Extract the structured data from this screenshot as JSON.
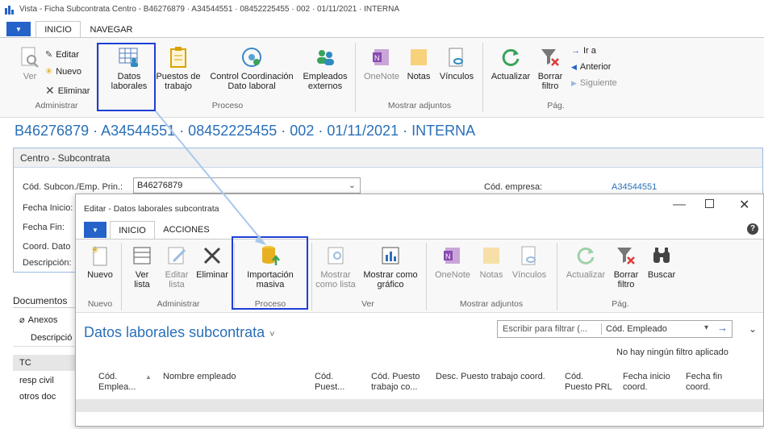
{
  "window": {
    "title": "Vista - Ficha Subcontrata Centro - B46276879 · A34544551 · 08452225455 · 002 · 01/11/2021 · INTERNA"
  },
  "main_tabs": {
    "inicio": "INICIO",
    "navegar": "NAVEGAR"
  },
  "main_ribbon": {
    "ver": "Ver",
    "editar": "Editar",
    "nuevo": "Nuevo",
    "eliminar": "Eliminar",
    "group_admin": "Administrar",
    "datos_laborales_1": "Datos",
    "datos_laborales_2": "laborales",
    "puestos_1": "Puestos de",
    "puestos_2": "trabajo",
    "control_1": "Control Coordinación",
    "control_2": "Dato laboral",
    "empleados_1": "Empleados",
    "empleados_2": "externos",
    "group_proceso": "Proceso",
    "onenote": "OneNote",
    "notas": "Notas",
    "vinculos": "Vínculos",
    "group_adjuntos": "Mostrar adjuntos",
    "actualizar": "Actualizar",
    "borrar_1": "Borrar",
    "borrar_2": "filtro",
    "ira": "Ir a",
    "anterior": "Anterior",
    "siguiente": "Siguiente",
    "group_pag": "Pág."
  },
  "page_title": "B46276879 · A34544551 · 08452225455 · 002 · 01/11/2021 · INTERNA",
  "centro": {
    "header": "Centro - Subcontrata",
    "cod_label": "Cód. Subcon./Emp. Prin.:",
    "cod_value": "B46276879",
    "fecha_inicio_label": "Fecha Inicio:",
    "fecha_fin_label": "Fecha Fin:",
    "coord_label": "Coord. Dato",
    "descripcion_label": "Descripción:",
    "empresa_label": "Cód. empresa:",
    "empresa_value": "A34544551"
  },
  "left_panel": {
    "documentos": "Documentos",
    "anexos": "Anexos",
    "descripcion": "Descripció",
    "tc": "TC",
    "resp": "resp civil",
    "otros": "otros doc"
  },
  "dialog": {
    "title": "Editar - Datos laborales subcontrata",
    "tab_inicio": "INICIO",
    "tab_acciones": "ACCIONES",
    "nuevo": "Nuevo",
    "ver_1": "Ver",
    "ver_2": "lista",
    "editar_1": "Editar",
    "editar_2": "lista",
    "eliminar": "Eliminar",
    "group_nuevo": "Nuevo",
    "group_admin": "Administrar",
    "importacion_1": "Importación",
    "importacion_2": "masiva",
    "group_proceso": "Proceso",
    "mostrar_lista_1": "Mostrar",
    "mostrar_lista_2": "como lista",
    "mostrar_grafico_1": "Mostrar como",
    "mostrar_grafico_2": "gráfico",
    "group_ver": "Ver",
    "onenote": "OneNote",
    "notas": "Notas",
    "vinculos": "Vínculos",
    "group_adjuntos": "Mostrar adjuntos",
    "actualizar": "Actualizar",
    "borrar_1": "Borrar",
    "borrar_2": "filtro",
    "buscar": "Buscar",
    "group_pag": "Pág.",
    "list_title": "Datos laborales subcontrata",
    "filter_placeholder": "Escribir para filtrar (...",
    "filter_field": "Cód. Empleado",
    "no_filter": "No hay ningún filtro aplicado",
    "columns": [
      {
        "l1": "Cód.",
        "l2": "Emplea..."
      },
      {
        "l1": "Nombre empleado",
        "l2": ""
      },
      {
        "l1": "Cód.",
        "l2": "Puest..."
      },
      {
        "l1": "Cód. Puesto",
        "l2": "trabajo co..."
      },
      {
        "l1": "Desc. Puesto trabajo coord.",
        "l2": ""
      },
      {
        "l1": "Cód.",
        "l2": "Puesto PRL"
      },
      {
        "l1": "Fecha inicio",
        "l2": "coord."
      },
      {
        "l1": "Fecha fin",
        "l2": "coord."
      }
    ]
  },
  "colors": {
    "accent": "#2563c8",
    "title_blue": "#2a6fb8",
    "highlight": "#1e3fd6"
  }
}
